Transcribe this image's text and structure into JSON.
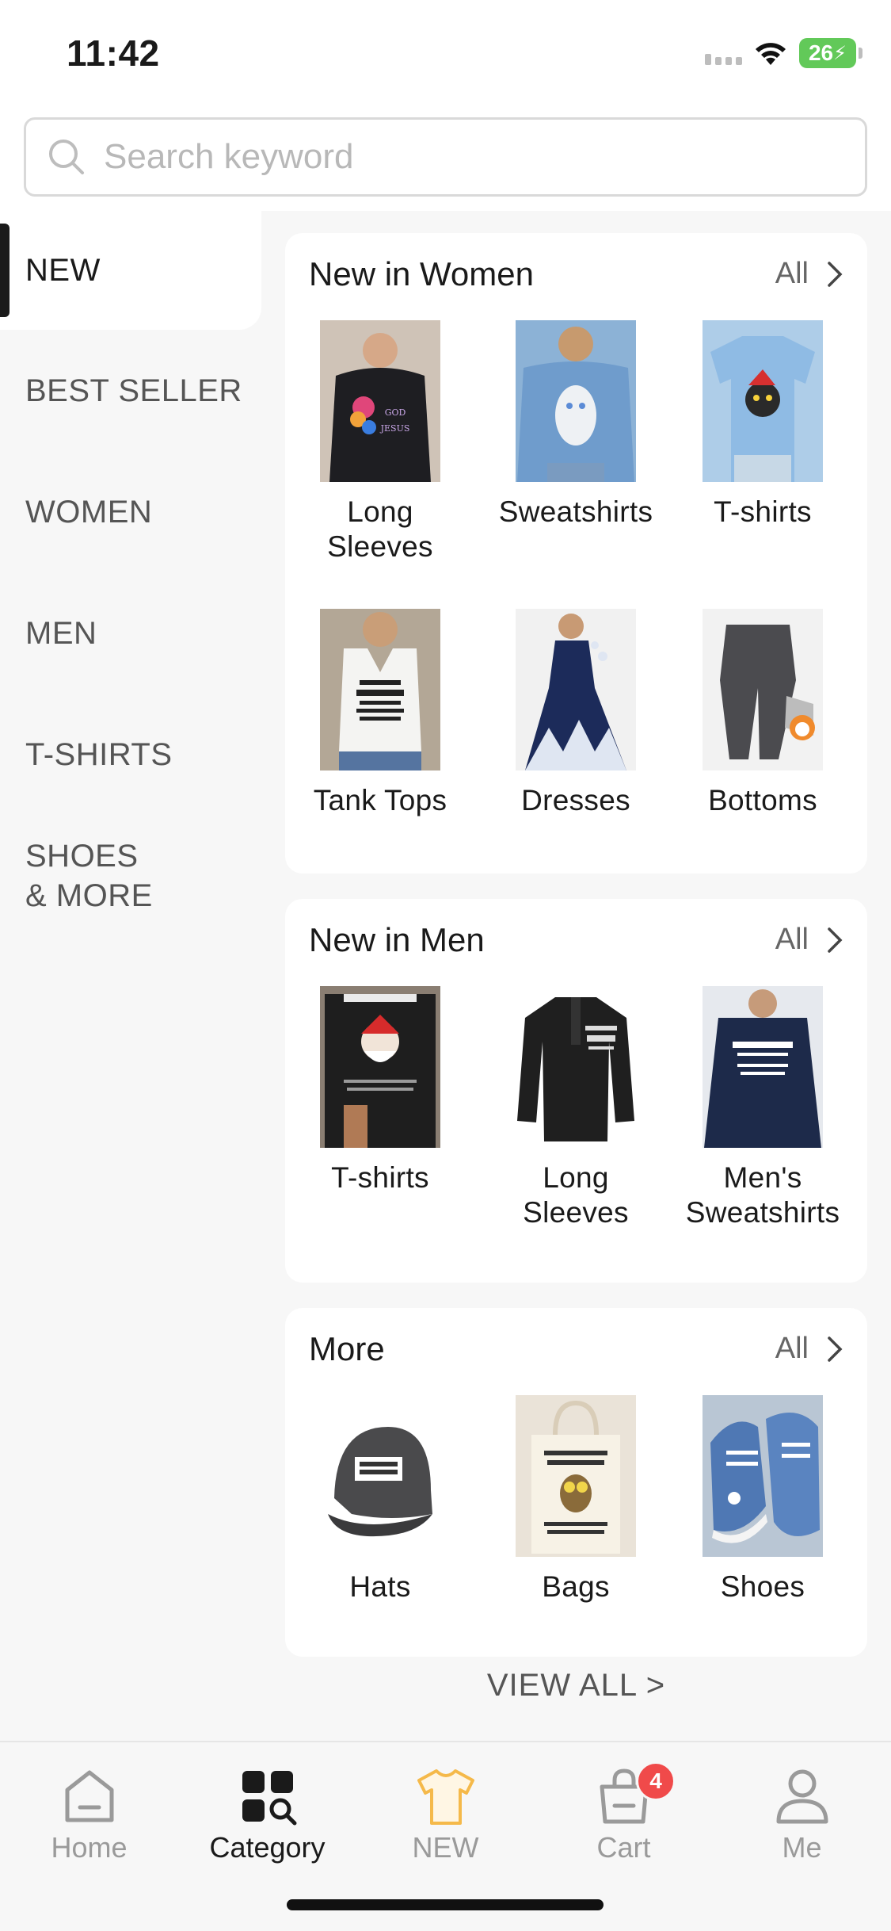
{
  "status_bar": {
    "time": "11:42",
    "battery": "26"
  },
  "search": {
    "placeholder": "Search keyword"
  },
  "sidebar": {
    "items": [
      {
        "label": "NEW"
      },
      {
        "label": "BEST SELLER"
      },
      {
        "label": "WOMEN"
      },
      {
        "label": "MEN"
      },
      {
        "label": "T-SHIRTS"
      },
      {
        "label_line1": "SHOES",
        "label_line2": "& MORE"
      }
    ]
  },
  "sections": [
    {
      "title": "New in Women",
      "all_label": "All",
      "items": [
        {
          "label": "Long Sleeves"
        },
        {
          "label": "Sweatshirts"
        },
        {
          "label": "T-shirts"
        },
        {
          "label": "Tank Tops"
        },
        {
          "label": "Dresses"
        },
        {
          "label": "Bottoms"
        }
      ]
    },
    {
      "title": "New in Men",
      "all_label": "All",
      "items": [
        {
          "label": "T-shirts"
        },
        {
          "label": "Long Sleeves"
        },
        {
          "label": "Men's Sweatshirts"
        }
      ]
    },
    {
      "title": "More",
      "all_label": "All",
      "items": [
        {
          "label": "Hats"
        },
        {
          "label": "Bags"
        },
        {
          "label": "Shoes"
        }
      ]
    }
  ],
  "view_all": "VIEW ALL >",
  "tabbar": {
    "items": [
      {
        "label": "Home",
        "icon": "home-icon"
      },
      {
        "label": "Category",
        "icon": "category-icon"
      },
      {
        "label": "NEW",
        "icon": "tshirt-icon"
      },
      {
        "label": "Cart",
        "icon": "bag-icon",
        "badge": "4"
      },
      {
        "label": "Me",
        "icon": "user-icon"
      }
    ]
  },
  "colors": {
    "accent": "#1a1a1a",
    "badge": "#f04a4a",
    "new_tab": "#f5b94a",
    "battery": "#62c959"
  }
}
